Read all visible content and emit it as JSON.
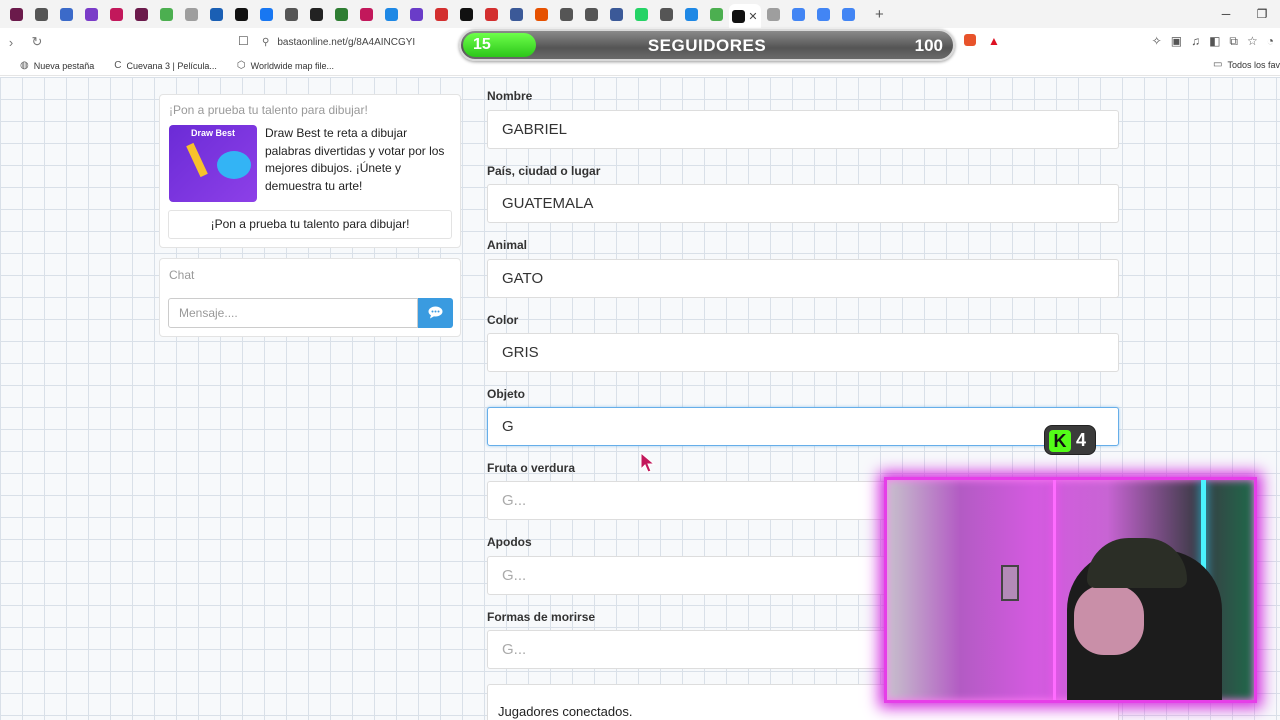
{
  "browser": {
    "tab_icon_colors": [
      "#6b1a4b",
      "#555",
      "#3b6ac9",
      "#7a3cc8",
      "#c2185b",
      "#6b1a4b",
      "#4caf50",
      "#9e9e9e",
      "#1a5fb4",
      "#111",
      "#1877f2",
      "#555",
      "#222",
      "#2e7d32",
      "#c2185b",
      "#1e88e5",
      "#6a3cc8",
      "#d32f2f",
      "#111",
      "#d32f2f",
      "#3b5998",
      "#e65100",
      "#555",
      "#555",
      "#3b5998",
      "#25d366",
      "#555",
      "#1e88e5",
      "#4caf50",
      "#111",
      "#9e9e9e",
      "#4285f4",
      "#4285f4",
      "#4285f4"
    ],
    "url": "bastaonline.net/g/8A4AINCGYI",
    "bookmarks": [
      {
        "label": "Nueva pestaña"
      },
      {
        "label": "Cuevana 3 | Película..."
      },
      {
        "label": "Worldwide map file..."
      }
    ],
    "bookmarks_right": "Todos los fav"
  },
  "followers_overlay": {
    "current": "15",
    "label": "SEGUIDORES",
    "goal": "100",
    "progress_fraction": 0.15
  },
  "promo": {
    "title": "¡Pon a prueba tu talento para dibujar!",
    "image_title": "Draw Best",
    "description": "Draw Best te reta a dibujar palabras divertidas y votar por los mejores dibujos. ¡Únete y demuestra tu arte!",
    "button_label": "¡Pon a prueba tu talento para dibujar!"
  },
  "chat": {
    "title": "Chat",
    "placeholder": "Mensaje...."
  },
  "form": {
    "fields": [
      {
        "label": "Nombre",
        "value": "GABRIEL",
        "placeholder": ""
      },
      {
        "label": "País, ciudad o lugar",
        "value": "GUATEMALA",
        "placeholder": ""
      },
      {
        "label": "Animal",
        "value": "GATO",
        "placeholder": ""
      },
      {
        "label": "Color",
        "value": "GRIS",
        "placeholder": ""
      },
      {
        "label": "Objeto",
        "value": "G",
        "placeholder": ""
      },
      {
        "label": "Fruta o verdura",
        "value": "",
        "placeholder": "G..."
      },
      {
        "label": "Apodos",
        "value": "",
        "placeholder": "G..."
      },
      {
        "label": "Formas de morirse",
        "value": "",
        "placeholder": "G..."
      }
    ],
    "players_label": "Jugadores conectados."
  },
  "kick_badge": {
    "logo": "K",
    "count": "4"
  }
}
